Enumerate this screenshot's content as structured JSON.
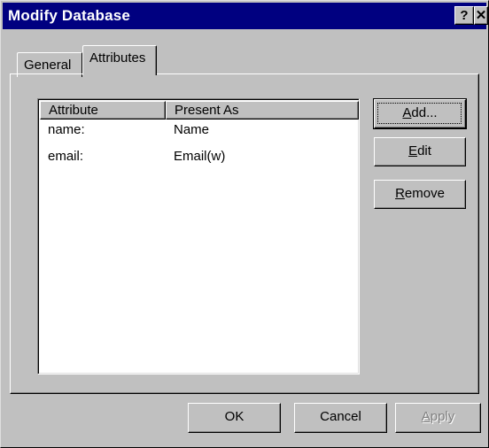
{
  "window": {
    "title": "Modify Database",
    "help_glyph": "?",
    "close_glyph": "✕"
  },
  "tabs": [
    {
      "label": "General",
      "selected": false
    },
    {
      "label": "Attributes",
      "selected": true
    }
  ],
  "list": {
    "columns": [
      "Attribute",
      "Present As"
    ],
    "rows": [
      {
        "attribute": "name:",
        "present_as": "Name"
      },
      {
        "attribute": "email:",
        "present_as": "Email(w)"
      }
    ]
  },
  "side_buttons": {
    "add": {
      "first": "A",
      "rest": "dd..."
    },
    "edit": {
      "first": "E",
      "rest": "dit"
    },
    "remove": {
      "first": "R",
      "rest": "emove"
    }
  },
  "footer_buttons": {
    "ok": "OK",
    "cancel": "Cancel",
    "apply": {
      "first": "A",
      "rest": "pply",
      "disabled": true
    }
  },
  "icons": {
    "help": "help-icon",
    "close": "close-icon"
  }
}
